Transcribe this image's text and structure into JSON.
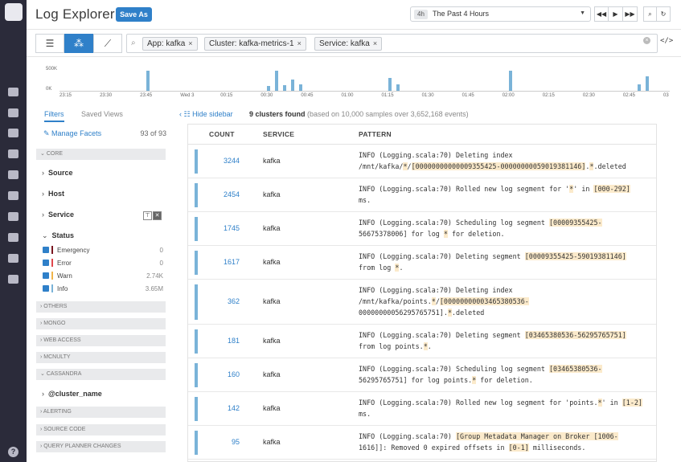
{
  "header": {
    "title": "Log Explorer",
    "save_as": "Save As"
  },
  "time": {
    "tag": "4h",
    "value": "The Past 4 Hours"
  },
  "query": {
    "chips": [
      "App: kafka",
      "Cluster: kafka-metrics-1",
      "Service: kafka"
    ],
    "remove_glyph": "×",
    "clear_glyph": "×",
    "code_glyph": "</>"
  },
  "histogram": {
    "y_labels": [
      "500K",
      "0K"
    ],
    "ticks": [
      "23:15",
      "23:30",
      "23:45",
      "Wed 3",
      "00:15",
      "00:30",
      "00:45",
      "01:00",
      "01:15",
      "01:30",
      "01:45",
      "02:00",
      "02:15",
      "02:30",
      "02:45",
      "03"
    ],
    "bars": [
      {
        "label": "23:45",
        "value": 0.95
      },
      {
        "label": "00:30",
        "value": 0.22
      },
      {
        "label": "00:33",
        "value": 0.95
      },
      {
        "label": "00:36",
        "value": 0.25
      },
      {
        "label": "00:39",
        "value": 0.55
      },
      {
        "label": "00:42",
        "value": 0.3
      },
      {
        "label": "01:15",
        "value": 0.6
      },
      {
        "label": "01:18",
        "value": 0.3
      },
      {
        "label": "02:00",
        "value": 0.95
      },
      {
        "label": "02:48",
        "value": 0.3
      },
      {
        "label": "02:51",
        "value": 0.7
      }
    ],
    "bar_color": "#7ab3d8"
  },
  "sidebar": {
    "tabs": [
      "Filters",
      "Saved Views"
    ],
    "manage": "Manage Facets",
    "facet_count": "93 of 93",
    "groups": [
      "CORE",
      "OTHERS",
      "MONGO",
      "WEB ACCESS",
      "MCNULTY",
      "CASSANDRA",
      "ALERTING",
      "SOURCE CODE",
      "QUERY PLANNER CHANGES"
    ],
    "facets": [
      "Source",
      "Host",
      "Service",
      "Status",
      "@cluster_name"
    ],
    "status": [
      {
        "label": "Emergency",
        "value": "0",
        "color": "#7a1620"
      },
      {
        "label": "Error",
        "value": "0",
        "color": "#e0474c"
      },
      {
        "label": "Warn",
        "value": "2.74K",
        "color": "#f0b44a"
      },
      {
        "label": "Info",
        "value": "3.65M",
        "color": "#7ab3d8"
      }
    ]
  },
  "main": {
    "hide_sidebar": "Hide sidebar",
    "found_bold": "9 clusters found",
    "found_sub": "(based on 10,000 samples over 3,652,168 events)",
    "columns": [
      "COUNT",
      "SERVICE",
      "PATTERN"
    ],
    "rows": [
      {
        "count": "3244",
        "service": "kafka",
        "pattern": "INFO (Logging.scala:70) Deleting index\n/mnt/kafka/*/[00000000000009355425-00000000059019381146].*.deleted"
      },
      {
        "count": "2454",
        "service": "kafka",
        "pattern": "INFO (Logging.scala:70) Rolled new log segment for '*' in [000-292]\nms."
      },
      {
        "count": "1745",
        "service": "kafka",
        "pattern": "INFO (Logging.scala:70) Scheduling log segment [00009355425-\n56675378006] for log * for deletion."
      },
      {
        "count": "1617",
        "service": "kafka",
        "pattern": "INFO (Logging.scala:70) Deleting segment [00009355425-59019381146]\nfrom log *."
      },
      {
        "count": "362",
        "service": "kafka",
        "pattern": "INFO (Logging.scala:70) Deleting index\n/mnt/kafka/points.*/[00000000003465380536-\n00000000056295765751].*.deleted"
      },
      {
        "count": "181",
        "service": "kafka",
        "pattern": "INFO (Logging.scala:70) Deleting segment [03465380536-56295765751]\nfrom log points.*."
      },
      {
        "count": "160",
        "service": "kafka",
        "pattern": "INFO (Logging.scala:70) Scheduling log segment [03465380536-\n56295765751] for log points.* for deletion."
      },
      {
        "count": "142",
        "service": "kafka",
        "pattern": "INFO (Logging.scala:70) Rolled new log segment for 'points.*' in [1-2]\nms."
      },
      {
        "count": "95",
        "service": "kafka",
        "pattern": "INFO (Logging.scala:70) [Group Metadata Manager on Broker [1006-\n1616]]: Removed 0 expired offsets in [0-1] milliseconds."
      }
    ]
  }
}
